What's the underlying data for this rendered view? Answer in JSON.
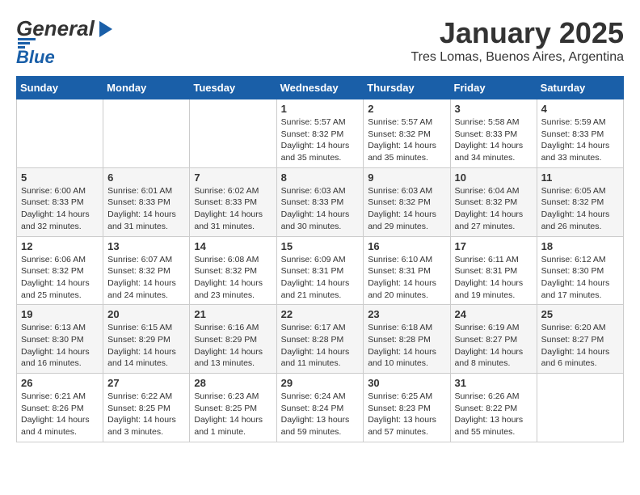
{
  "header": {
    "logo_text_general": "General",
    "logo_text_blue": "Blue",
    "title": "January 2025",
    "subtitle": "Tres Lomas, Buenos Aires, Argentina"
  },
  "calendar": {
    "weekdays": [
      "Sunday",
      "Monday",
      "Tuesday",
      "Wednesday",
      "Thursday",
      "Friday",
      "Saturday"
    ],
    "weeks": [
      [
        {
          "day": "",
          "info": ""
        },
        {
          "day": "",
          "info": ""
        },
        {
          "day": "",
          "info": ""
        },
        {
          "day": "1",
          "info": "Sunrise: 5:57 AM\nSunset: 8:32 PM\nDaylight: 14 hours\nand 35 minutes."
        },
        {
          "day": "2",
          "info": "Sunrise: 5:57 AM\nSunset: 8:32 PM\nDaylight: 14 hours\nand 35 minutes."
        },
        {
          "day": "3",
          "info": "Sunrise: 5:58 AM\nSunset: 8:33 PM\nDaylight: 14 hours\nand 34 minutes."
        },
        {
          "day": "4",
          "info": "Sunrise: 5:59 AM\nSunset: 8:33 PM\nDaylight: 14 hours\nand 33 minutes."
        }
      ],
      [
        {
          "day": "5",
          "info": "Sunrise: 6:00 AM\nSunset: 8:33 PM\nDaylight: 14 hours\nand 32 minutes."
        },
        {
          "day": "6",
          "info": "Sunrise: 6:01 AM\nSunset: 8:33 PM\nDaylight: 14 hours\nand 31 minutes."
        },
        {
          "day": "7",
          "info": "Sunrise: 6:02 AM\nSunset: 8:33 PM\nDaylight: 14 hours\nand 31 minutes."
        },
        {
          "day": "8",
          "info": "Sunrise: 6:03 AM\nSunset: 8:33 PM\nDaylight: 14 hours\nand 30 minutes."
        },
        {
          "day": "9",
          "info": "Sunrise: 6:03 AM\nSunset: 8:32 PM\nDaylight: 14 hours\nand 29 minutes."
        },
        {
          "day": "10",
          "info": "Sunrise: 6:04 AM\nSunset: 8:32 PM\nDaylight: 14 hours\nand 27 minutes."
        },
        {
          "day": "11",
          "info": "Sunrise: 6:05 AM\nSunset: 8:32 PM\nDaylight: 14 hours\nand 26 minutes."
        }
      ],
      [
        {
          "day": "12",
          "info": "Sunrise: 6:06 AM\nSunset: 8:32 PM\nDaylight: 14 hours\nand 25 minutes."
        },
        {
          "day": "13",
          "info": "Sunrise: 6:07 AM\nSunset: 8:32 PM\nDaylight: 14 hours\nand 24 minutes."
        },
        {
          "day": "14",
          "info": "Sunrise: 6:08 AM\nSunset: 8:32 PM\nDaylight: 14 hours\nand 23 minutes."
        },
        {
          "day": "15",
          "info": "Sunrise: 6:09 AM\nSunset: 8:31 PM\nDaylight: 14 hours\nand 21 minutes."
        },
        {
          "day": "16",
          "info": "Sunrise: 6:10 AM\nSunset: 8:31 PM\nDaylight: 14 hours\nand 20 minutes."
        },
        {
          "day": "17",
          "info": "Sunrise: 6:11 AM\nSunset: 8:31 PM\nDaylight: 14 hours\nand 19 minutes."
        },
        {
          "day": "18",
          "info": "Sunrise: 6:12 AM\nSunset: 8:30 PM\nDaylight: 14 hours\nand 17 minutes."
        }
      ],
      [
        {
          "day": "19",
          "info": "Sunrise: 6:13 AM\nSunset: 8:30 PM\nDaylight: 14 hours\nand 16 minutes."
        },
        {
          "day": "20",
          "info": "Sunrise: 6:15 AM\nSunset: 8:29 PM\nDaylight: 14 hours\nand 14 minutes."
        },
        {
          "day": "21",
          "info": "Sunrise: 6:16 AM\nSunset: 8:29 PM\nDaylight: 14 hours\nand 13 minutes."
        },
        {
          "day": "22",
          "info": "Sunrise: 6:17 AM\nSunset: 8:28 PM\nDaylight: 14 hours\nand 11 minutes."
        },
        {
          "day": "23",
          "info": "Sunrise: 6:18 AM\nSunset: 8:28 PM\nDaylight: 14 hours\nand 10 minutes."
        },
        {
          "day": "24",
          "info": "Sunrise: 6:19 AM\nSunset: 8:27 PM\nDaylight: 14 hours\nand 8 minutes."
        },
        {
          "day": "25",
          "info": "Sunrise: 6:20 AM\nSunset: 8:27 PM\nDaylight: 14 hours\nand 6 minutes."
        }
      ],
      [
        {
          "day": "26",
          "info": "Sunrise: 6:21 AM\nSunset: 8:26 PM\nDaylight: 14 hours\nand 4 minutes."
        },
        {
          "day": "27",
          "info": "Sunrise: 6:22 AM\nSunset: 8:25 PM\nDaylight: 14 hours\nand 3 minutes."
        },
        {
          "day": "28",
          "info": "Sunrise: 6:23 AM\nSunset: 8:25 PM\nDaylight: 14 hours\nand 1 minute."
        },
        {
          "day": "29",
          "info": "Sunrise: 6:24 AM\nSunset: 8:24 PM\nDaylight: 13 hours\nand 59 minutes."
        },
        {
          "day": "30",
          "info": "Sunrise: 6:25 AM\nSunset: 8:23 PM\nDaylight: 13 hours\nand 57 minutes."
        },
        {
          "day": "31",
          "info": "Sunrise: 6:26 AM\nSunset: 8:22 PM\nDaylight: 13 hours\nand 55 minutes."
        },
        {
          "day": "",
          "info": ""
        }
      ]
    ]
  }
}
